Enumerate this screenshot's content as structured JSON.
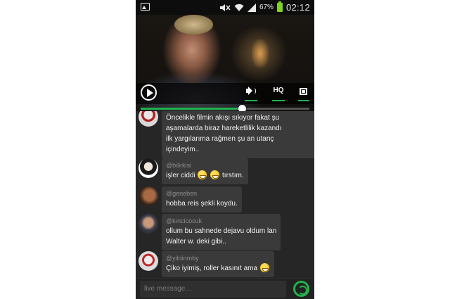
{
  "status_bar": {
    "battery_percent": "67%",
    "time": "02:12",
    "icons": [
      "gallery-icon",
      "mute-icon",
      "wifi-icon",
      "signal-icon",
      "battery-icon"
    ],
    "battery_color": "#7ed321"
  },
  "video": {
    "accent": "#22b14c",
    "controls": {
      "play_icon": "play-icon",
      "volume_icon": "volume-icon",
      "hq_label": "HQ",
      "fullscreen_icon": "fullscreen-icon"
    },
    "progress": 0.6
  },
  "chat": {
    "messages": [
      {
        "user": "",
        "lines": [
          "Öncelikle filmin akışı sıkıyor fakat şu",
          "aşamalarda biraz hareketlilik kazandı",
          "ilk yargılarıma rağmen şu an utanç",
          "içindeyim.."
        ]
      },
      {
        "user": "@bilirkisi",
        "text_before": "işler ciddi",
        "emojis": [
          "grimacing-emoji",
          "grin-emoji"
        ],
        "text_after": "tırstım."
      },
      {
        "user": "@geneben",
        "lines": [
          "hobba reis şekli koydu."
        ]
      },
      {
        "user": "@kıncicocuk",
        "lines": [
          "ollum bu sahnede dejavu oldum lan",
          "Walter w. deki gibi.."
        ]
      },
      {
        "user": "@yildirimby",
        "text_before": "Çiko iyimiş, roller kasınıt ama",
        "emojis": [
          "grin-emoji"
        ],
        "text_after": ""
      }
    ]
  },
  "composer": {
    "placeholder": "live message...",
    "send_icon": "send-icon"
  }
}
